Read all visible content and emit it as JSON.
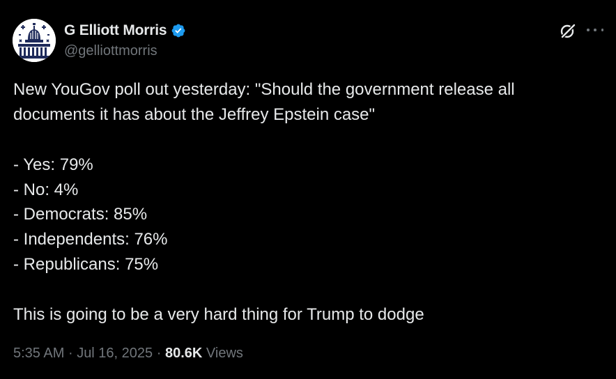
{
  "author": {
    "display_name": "G Elliott Morris",
    "handle": "@gelliottmorris",
    "verified_color": "#1d9bf0"
  },
  "icons": {
    "avatar": "capitol-dome-avatar",
    "verified": "verified-badge-icon",
    "grok": "grok-slash-icon",
    "more": "more-horizontal-icon"
  },
  "tweet": {
    "lines": [
      "New YouGov poll out yesterday: \"Should the government release all",
      "documents it has about the Jeffrey Epstein case\"",
      "",
      "- Yes: 79%",
      "- No: 4%",
      "- Democrats: 85%",
      "- Independents: 76%",
      "- Republicans: 75%",
      "",
      "This is going to be a very hard thing for Trump to dodge"
    ]
  },
  "meta": {
    "time": "5:35 AM",
    "separator": "·",
    "date": "Jul 16, 2025",
    "views_count": "80.6K",
    "views_label": "Views"
  },
  "colors": {
    "background": "#000000",
    "primary_text": "#e7e9ea",
    "secondary_text": "#71767b",
    "accent": "#1d9bf0"
  }
}
